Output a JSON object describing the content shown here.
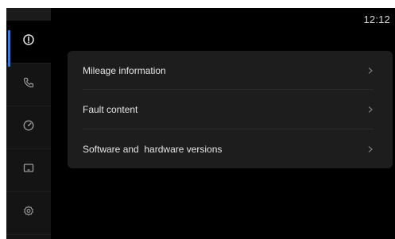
{
  "status_bar": {
    "time": "12:12"
  },
  "sidebar": {
    "items": [
      {
        "icon": "info-icon",
        "active": true
      },
      {
        "icon": "phone-icon",
        "active": false
      },
      {
        "icon": "gauge-icon",
        "active": false
      },
      {
        "icon": "screen-icon",
        "active": false
      },
      {
        "icon": "gear-icon",
        "active": false
      }
    ]
  },
  "menu": {
    "items": [
      {
        "label": "Mileage information",
        "icon": "chevron-right-icon"
      },
      {
        "label": "Fault content",
        "icon": "chevron-right-icon"
      },
      {
        "label": "Software and  hardware versions",
        "icon": "chevron-right-icon"
      }
    ]
  },
  "colors": {
    "accent": "#2f7bf6",
    "background": "#000000",
    "sidebar": "#141414",
    "panel": "#1d1d1d",
    "text": "#e6e6e6"
  }
}
